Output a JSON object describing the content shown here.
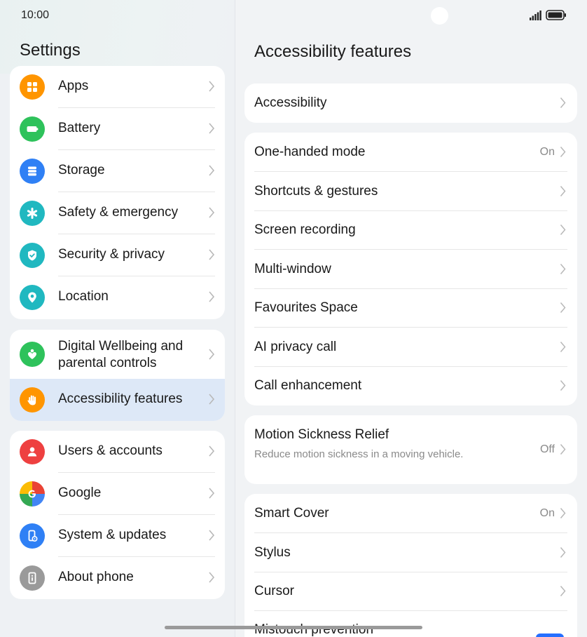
{
  "status": {
    "time": "10:00"
  },
  "left": {
    "title": "Settings",
    "group1": [
      {
        "label": "Apps",
        "icon": "apps-icon",
        "color": "#ff9500"
      },
      {
        "label": "Battery",
        "icon": "battery-icon",
        "color": "#2ec25b"
      },
      {
        "label": "Storage",
        "icon": "storage-icon",
        "color": "#2f80f5"
      },
      {
        "label": "Safety & emergency",
        "icon": "asterisk-icon",
        "color": "#20b8c0"
      },
      {
        "label": "Security & privacy",
        "icon": "shield-icon",
        "color": "#20b8c0"
      },
      {
        "label": "Location",
        "icon": "location-pin-icon",
        "color": "#20b8c0"
      }
    ],
    "group2": [
      {
        "label": "Digital Wellbeing and parental controls",
        "icon": "heart-person-icon",
        "color": "#2ec25b"
      },
      {
        "label": "Accessibility features",
        "icon": "hand-icon",
        "color": "#ff9500",
        "selected": true
      }
    ],
    "group3": [
      {
        "label": "Users & accounts",
        "icon": "user-icon",
        "color": "#ee4040"
      },
      {
        "label": "Google",
        "icon": "google-icon",
        "color": "#ffffff"
      },
      {
        "label": "System & updates",
        "icon": "phone-gear-icon",
        "color": "#2f80f5"
      },
      {
        "label": "About phone",
        "icon": "info-icon",
        "color": "#9a9a9a"
      }
    ]
  },
  "right": {
    "title": "Accessibility features",
    "card1": [
      {
        "label": "Accessibility",
        "value": ""
      }
    ],
    "card2": [
      {
        "label": "One-handed mode",
        "value": "On"
      },
      {
        "label": "Shortcuts & gestures",
        "value": ""
      },
      {
        "label": "Screen recording",
        "value": ""
      },
      {
        "label": "Multi-window",
        "value": ""
      },
      {
        "label": "Favourites Space",
        "value": ""
      },
      {
        "label": "AI privacy call",
        "value": ""
      },
      {
        "label": "Call enhancement",
        "value": ""
      }
    ],
    "card3": {
      "label": "Motion Sickness Relief",
      "subtitle": "Reduce motion sickness in a moving vehicle.",
      "value": "Off"
    },
    "card4": [
      {
        "label": "Smart Cover",
        "value": "On"
      },
      {
        "label": "Stylus",
        "value": ""
      },
      {
        "label": "Cursor",
        "value": ""
      },
      {
        "label": "Mistouch prevention",
        "value": ""
      }
    ]
  },
  "colors": {
    "accent": "#256fff",
    "selected_bg": "#dde8f7"
  }
}
